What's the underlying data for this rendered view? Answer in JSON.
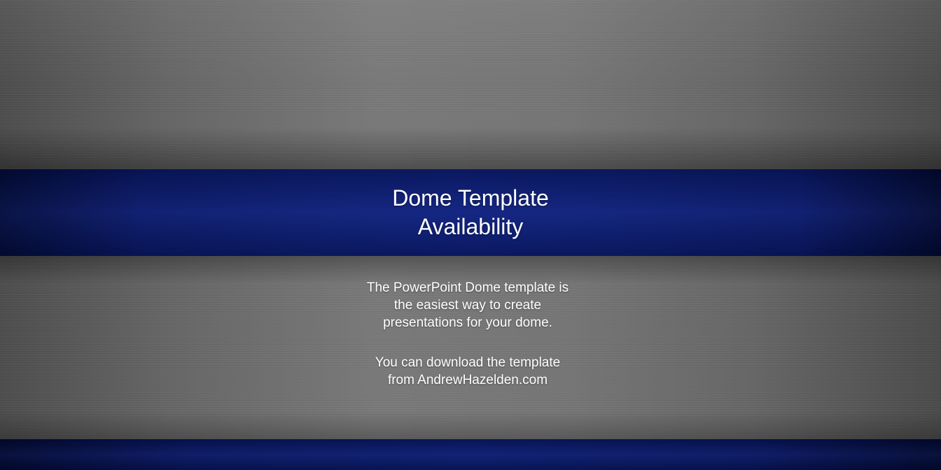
{
  "slide": {
    "title_line_1": "Dome Template",
    "title_line_2": "Availability",
    "paragraph_1": [
      "The PowerPoint Dome template is",
      "the easiest way to create",
      "presentations for your dome."
    ],
    "paragraph_2": [
      "You can download the template",
      "from AndrewHazelden.com"
    ]
  },
  "colors": {
    "band_blue": "#0d1f7a",
    "metal_gray": "#6a6a6a",
    "text": "#ffffff"
  }
}
